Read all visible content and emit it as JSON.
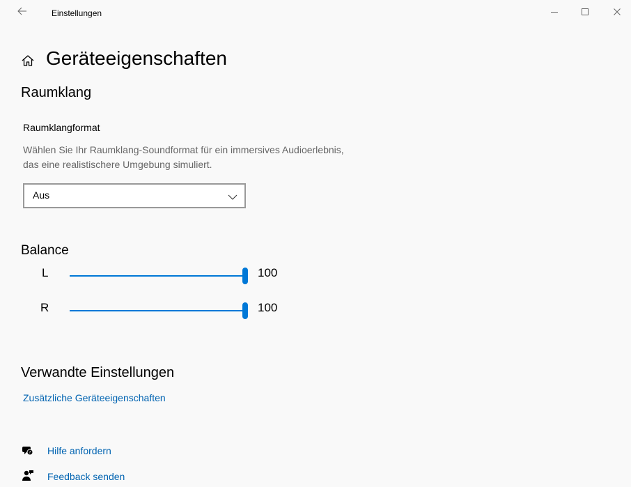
{
  "window": {
    "back_icon": "arrow-left-icon",
    "title": "Einstellungen",
    "minimize_icon": "minimize-icon",
    "maximize_icon": "maximize-icon",
    "close_icon": "close-icon"
  },
  "page": {
    "home_icon": "home-icon",
    "title": "Geräteeigenschaften"
  },
  "spatial": {
    "section_title": "Raumklang",
    "format_label": "Raumklangformat",
    "description": "Wählen Sie Ihr Raumklang-Soundformat für ein immersives Audioerlebnis, das eine realistischere Umgebung simuliert.",
    "selected": "Aus"
  },
  "balance": {
    "title": "Balance",
    "left_label": "L",
    "left_value": "100",
    "right_label": "R",
    "right_value": "100",
    "max": 100,
    "accent": "#0078d7"
  },
  "related": {
    "title": "Verwandte Einstellungen",
    "link": "Zusätzliche Geräteeigenschaften"
  },
  "help": {
    "get_help": "Hilfe anfordern",
    "get_help_icon": "help-chat-icon",
    "feedback": "Feedback senden",
    "feedback_icon": "feedback-person-icon"
  }
}
